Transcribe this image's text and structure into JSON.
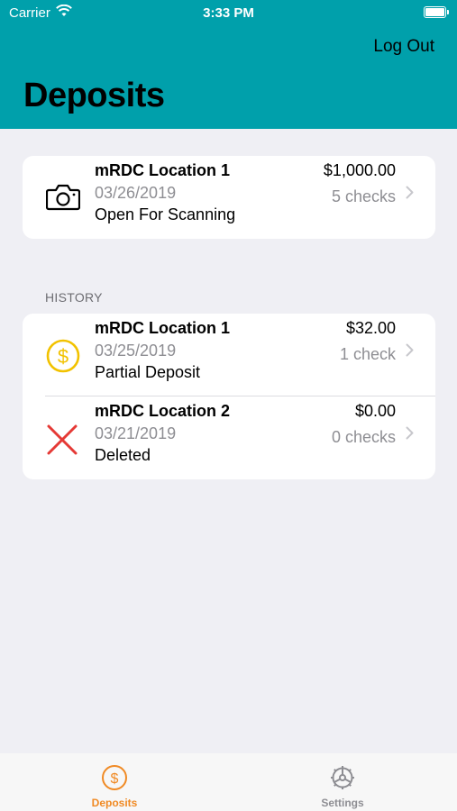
{
  "status_bar": {
    "carrier": "Carrier",
    "time": "3:33 PM"
  },
  "header": {
    "logout_label": "Log Out",
    "title": "Deposits"
  },
  "current": {
    "name": "mRDC Location 1",
    "date": "03/26/2019",
    "status": "Open For Scanning",
    "amount": "$1,000.00",
    "checks": "5 checks",
    "icon": "camera-icon"
  },
  "history": {
    "header": "HISTORY",
    "items": [
      {
        "name": "mRDC Location 1",
        "date": "03/25/2019",
        "status": "Partial Deposit",
        "amount": "$32.00",
        "checks": "1 check",
        "icon": "dollar-coin-icon",
        "icon_color": "#f2c200"
      },
      {
        "name": "mRDC Location 2",
        "date": "03/21/2019",
        "status": "Deleted",
        "amount": "$0.00",
        "checks": "0 checks",
        "icon": "x-mark-icon",
        "icon_color": "#e53935"
      }
    ]
  },
  "tab_bar": {
    "tabs": [
      {
        "label": "Deposits",
        "icon": "dollar-circle-icon",
        "color": "#f08a24",
        "selected": true
      },
      {
        "label": "Settings",
        "icon": "settings-gear-icon",
        "color": "#8e8e93",
        "selected": false
      }
    ]
  },
  "colors": {
    "header_bg": "#00a0ab",
    "page_bg": "#efeff4",
    "accent": "#f08a24"
  }
}
